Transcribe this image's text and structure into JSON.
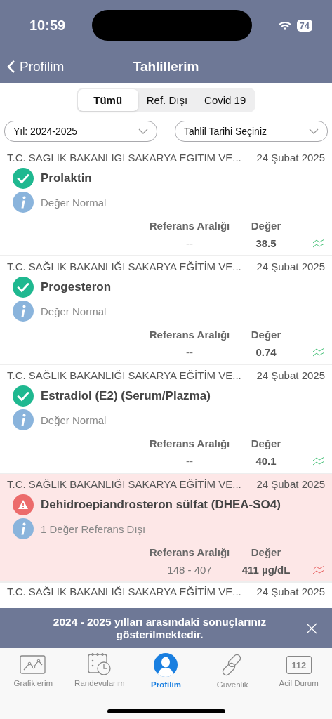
{
  "status_bar": {
    "time": "10:59",
    "battery": "74"
  },
  "nav": {
    "back": "Profilim",
    "title": "Tahlillerim"
  },
  "segments": [
    {
      "label": "Tümü",
      "selected": true
    },
    {
      "label": "Ref. Dışı",
      "selected": false
    },
    {
      "label": "Covid 19",
      "selected": false
    }
  ],
  "filters": [
    {
      "value": "Yıl: 2024-2025"
    },
    {
      "value": "Tahlil Tarihi Seçiniz"
    }
  ],
  "results": [
    {
      "institution": "T.C. SAGLIK BAKANLIGI SAKARYA EGITIM VE...",
      "date": "24 Şubat 2025",
      "test": "Prolaktin",
      "kind": "normal",
      "note": "Değer Normal",
      "range_label": "Referans Aralığı",
      "value_label": "Değer",
      "range": "--",
      "value": "38.5"
    },
    {
      "institution": "T.C. SAĞLIK BAKANLIĞI SAKARYA EĞİTİM VE...",
      "date": "24 Şubat 2025",
      "test": "Progesteron",
      "kind": "normal",
      "note": "Değer Normal",
      "range_label": "Referans Aralığı",
      "value_label": "Değer",
      "range": "--",
      "value": "0.74"
    },
    {
      "institution": "T.C. SAĞLIK BAKANLIĞI SAKARYA EĞİTİM VE...",
      "date": "24 Şubat 2025",
      "test": "Estradiol (E2) (Serum/Plazma)",
      "kind": "normal",
      "note": "Değer Normal",
      "range_label": "Referans Aralığı",
      "value_label": "Değer",
      "range": "--",
      "value": "40.1"
    },
    {
      "institution": "T.C. SAĞLIK BAKANLIĞI SAKARYA EĞİTİM VE...",
      "date": "24 Şubat 2025",
      "test": "Dehidroepiandrosteron sülfat (DHEA-SO4)",
      "kind": "abnormal",
      "note": "1 Değer Referans Dışı",
      "range_label": "Referans Aralığı",
      "value_label": "Değer",
      "range": "148 - 407",
      "value": "411 µg/dL"
    }
  ],
  "partial_row": {
    "institution": "T.C. SAĞLIK BAKANLIĞI SAKARYA EĞİTİM VE...",
    "date": "24 Şubat 2025"
  },
  "banner": {
    "message": "2024 - 2025 yılları arasındaki sonuçlarınız gösterilmektedir."
  },
  "tabbar": [
    {
      "label": "Grafiklerim",
      "kind": "chart",
      "selected": false
    },
    {
      "label": "Randevularım",
      "kind": "calendar",
      "selected": false
    },
    {
      "label": "Profilim",
      "kind": "profile",
      "selected": true
    },
    {
      "label": "Güvenlik",
      "kind": "link",
      "selected": false
    },
    {
      "label": "Acil Durum",
      "kind": "emergency",
      "badge": "112",
      "selected": false
    }
  ]
}
